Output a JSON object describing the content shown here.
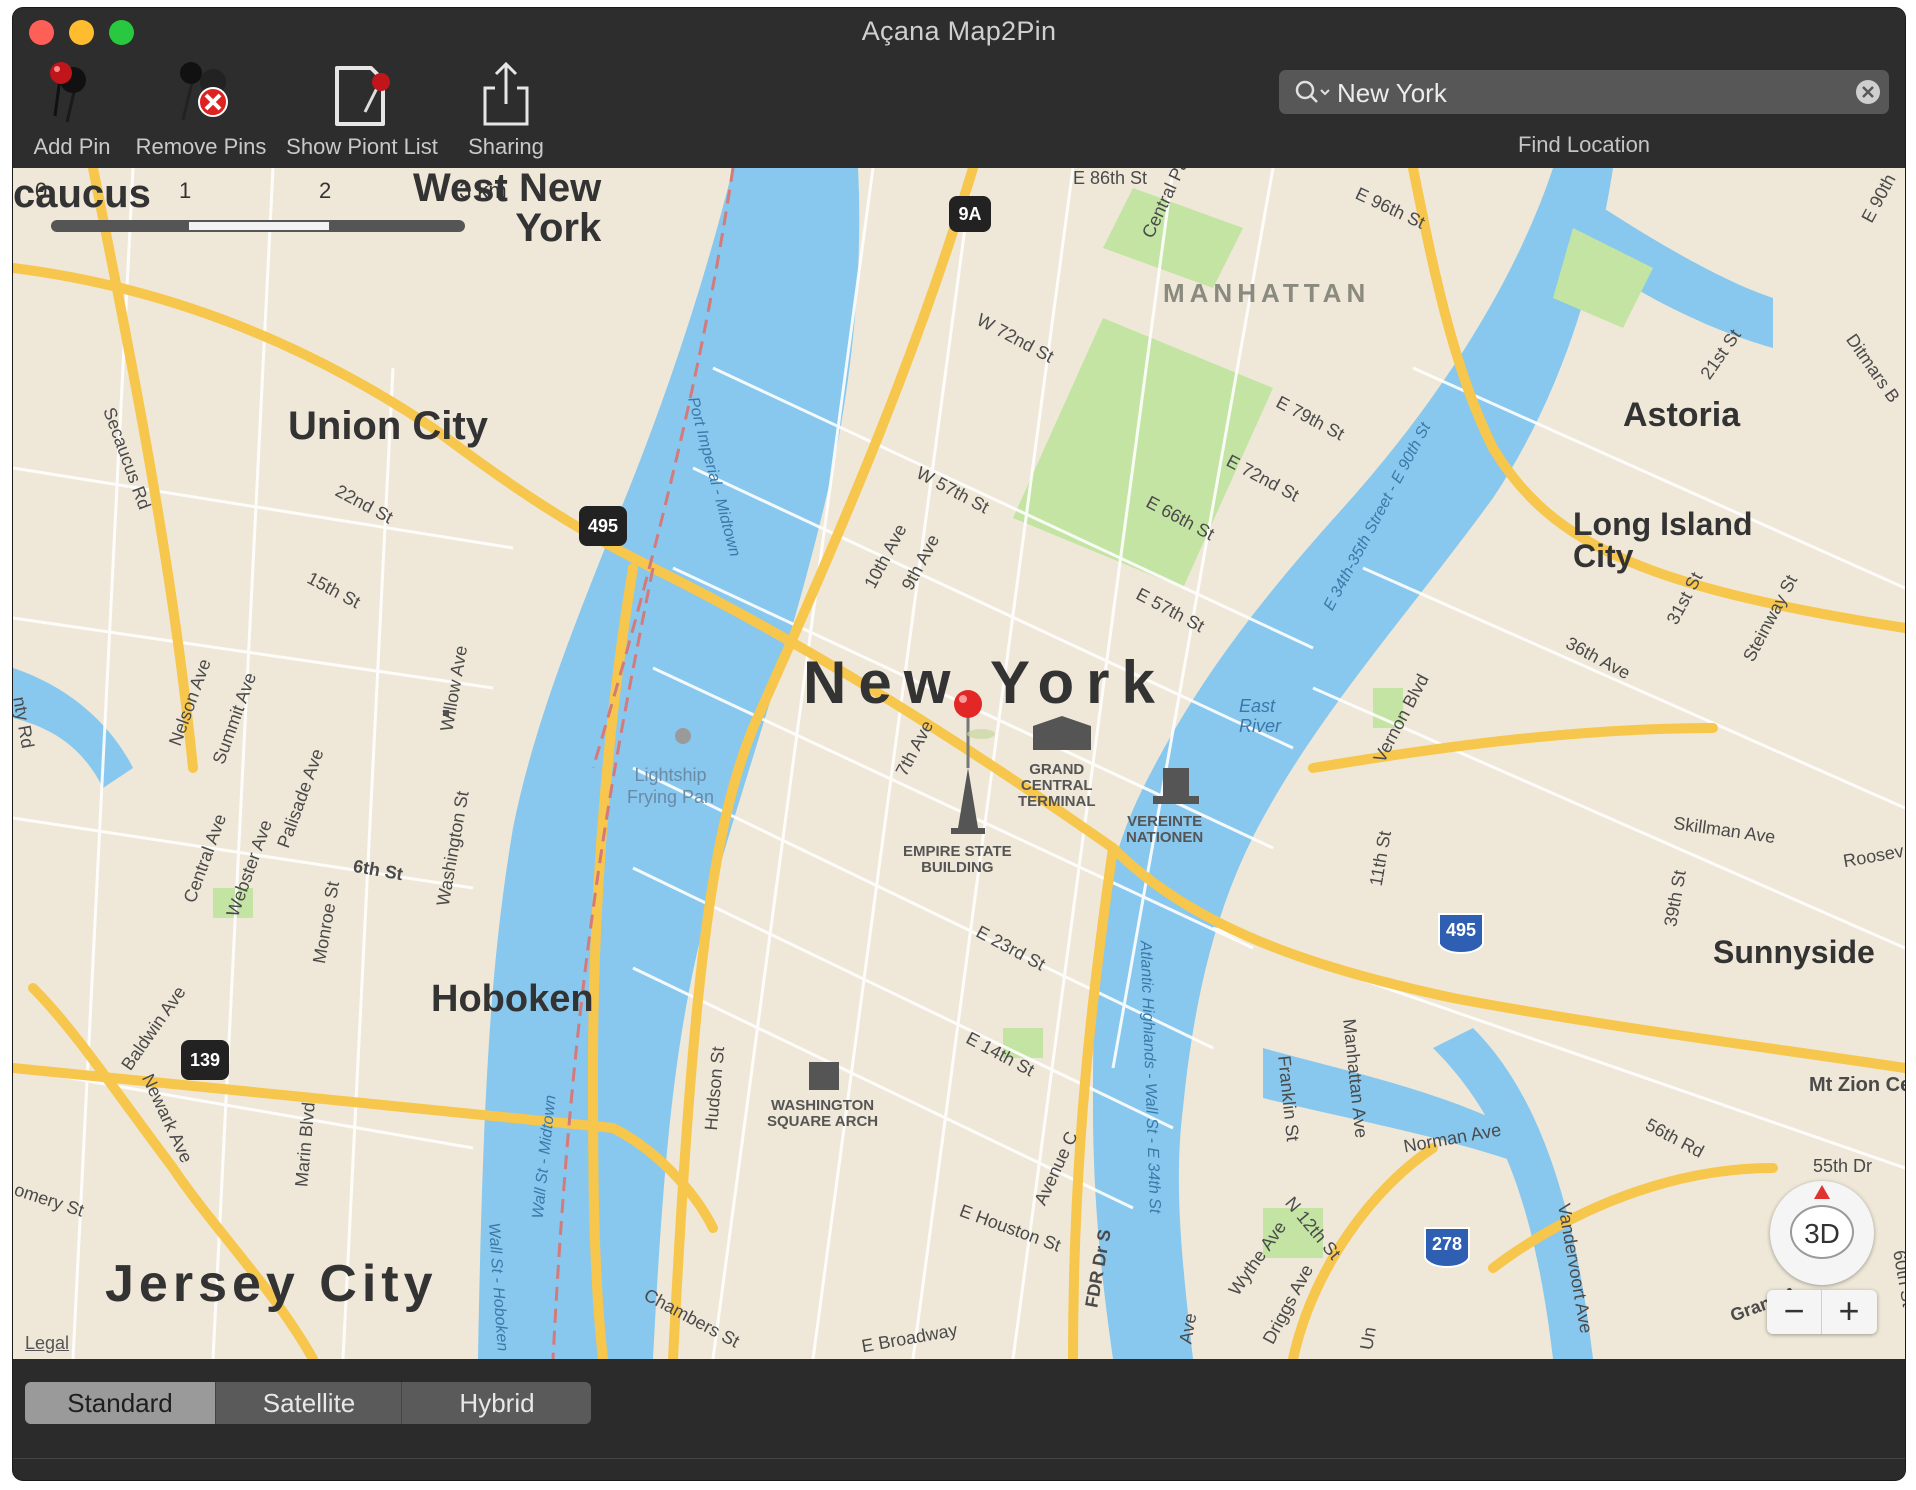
{
  "window": {
    "title": "Açana Map2Pin"
  },
  "toolbar": {
    "add_pin": "Add Pin",
    "remove_pins": "Remove Pins",
    "show_point_list": "Show Piont List",
    "sharing": "Sharing"
  },
  "search": {
    "value": "New York",
    "label": "Find Location"
  },
  "map": {
    "scale": {
      "n0": "0",
      "n1": "1",
      "n2": "2",
      "n3": "3 km"
    },
    "labels": {
      "west_new_york": "West New\nYork",
      "secaucus": "caucus",
      "manhattan": "MANHATTAN",
      "union_city": "Union City",
      "astoria": "Astoria",
      "long_island_city": "Long Island\nCity",
      "new_york": "New York",
      "hoboken": "Hoboken",
      "jersey_city": "Jersey City",
      "sunnyside": "Sunnyside",
      "mt_zion": "Mt Zion Ce",
      "east_river": "East\nRiver",
      "lightship": "Lightship\nFrying Pan",
      "grand_central": "GRAND\nCENTRAL\nTERMINAL",
      "vereinte": "VEREINTE\nNATIONEN",
      "empire_state": "EMPIRE STATE\nBUILDING",
      "washington_arch": "WASHINGTON\nSQUARE ARCH",
      "legal": "Legal"
    },
    "streets": {
      "e86": "E 86th St",
      "e96": "E 96th St",
      "central_park": "Central Pa",
      "w72": "W 72nd St",
      "e79": "E 79th St",
      "e72": "E 72nd St",
      "e66": "E 66th St",
      "w57": "W 57th St",
      "e57": "E 57th St",
      "tenth": "10th Ave",
      "ninth": "9th Ave",
      "seventh": "7th Ave",
      "secaucus_rd": "Secaucus Rd",
      "st22": "22nd St",
      "st15": "15th St",
      "willow": "Willow Ave",
      "nelson": "Nelson Ave",
      "summit": "Summit Ave",
      "central_ave": "Central Ave",
      "webster": "Webster Ave",
      "palisade": "Palisade Ave",
      "washington_st": "Washington St",
      "sixth": "6th St",
      "monroe": "Monroe St",
      "baldwin": "Baldwin Ave",
      "newark": "Newark Ave",
      "marin": "Marin Blvd",
      "montgomery": "omery St",
      "hudson": "Hudson St",
      "e23": "E 23rd St",
      "e14": "E 14th St",
      "avec": "Avenue C",
      "e_houston": "E Houston St",
      "fdr": "FDR Dr S",
      "chambers": "Chambers St",
      "e_broadway": "E Broadway",
      "port_imperial": "Port Imperial - Midtown",
      "wall_st": "Wall St - Midtown",
      "wall_hoboken": "Wall St - Hoboken",
      "atlantic": "Atlantic Highlands - Wall St - E 34th St",
      "e34": "E 34th-35th Street - E 90th St",
      "vernon": "Vernon Blvd",
      "st31": "31st St",
      "steinway": "Steinway St",
      "ave36": "36th Ave",
      "st21": "21st St",
      "ditmars": "Ditmars B",
      "e90": "E 90th",
      "skillman": "Skillman Ave",
      "roosevelt": "Roosev",
      "st39": "39th St",
      "st11": "11th St",
      "franklin": "Franklin St",
      "manhattan_ave": "Manhattan Ave",
      "norman": "Norman Ave",
      "rd56": "56th Rd",
      "dr55": "55th Dr",
      "n12": "N 12th St",
      "wythe": "Wythe Ave",
      "driggs": "Driggs Ave",
      "vandervoort": "Vandervoort Ave",
      "grand": "Grand A",
      "st60": "60th St",
      "tonty": "nty Rd",
      "ave_label": "Ave",
      "un": "Un"
    },
    "shields": {
      "s9a": "9A",
      "s495a": "495",
      "s495b": "495",
      "s139": "139",
      "s278": "278"
    },
    "controls": {
      "compass": "3D",
      "zoom_out": "−",
      "zoom_in": "+"
    }
  },
  "view_modes": {
    "standard": "Standard",
    "satellite": "Satellite",
    "hybrid": "Hybrid"
  },
  "colors": {
    "water": "#88c8ee",
    "park": "#c4e4a4",
    "road_major": "#f7c64c",
    "land": "#efe8d8",
    "pin": "#e32727"
  }
}
